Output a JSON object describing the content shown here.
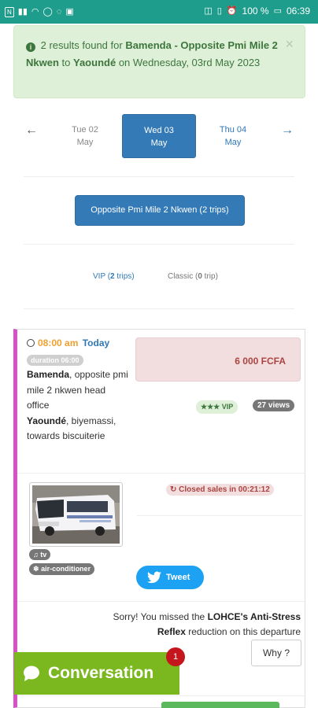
{
  "status_bar": {
    "left_icons": [
      "network-icon",
      "signal-icon",
      "wifi-icon",
      "whatsapp-icon",
      "circle-icon",
      "gallery-icon"
    ],
    "battery_percent": "100 %",
    "time": "06:39"
  },
  "alert": {
    "count_text": "2 results found for",
    "origin": "Bamenda - Opposite Pmi Mile 2 Nkwen",
    "to_text": "to",
    "destination": "Yaoundé",
    "date_text": "on Wednesday, 03rd May 2023",
    "close_label": "×"
  },
  "date_nav": {
    "prev_arrow": "←",
    "next_arrow": "→",
    "days": [
      {
        "day": "Tue 02",
        "month": "May",
        "active": false
      },
      {
        "day": "Wed 03",
        "month": "May",
        "active": true
      },
      {
        "day": "Thu 04",
        "month": "May",
        "active": false
      }
    ]
  },
  "departure_button": "Opposite Pmi Mile 2 Nkwen (2 trips)",
  "class_filters": {
    "vip_prefix": "VIP (",
    "vip_count": "2",
    "vip_suffix": " trips)",
    "classic_prefix": "Classic (",
    "classic_count": "0",
    "classic_suffix": " trip)"
  },
  "trip": {
    "time": "08:00 am",
    "day": "Today",
    "duration": "duration 06:00",
    "origin_city": "Bamenda",
    "origin_detail": ", opposite pmi mile 2 nkwen head office",
    "destination_city": "Yaoundé",
    "destination_detail": ", biyemassi, towards biscuiterie",
    "price": "6 000 FCFA",
    "class_badge": "VIP",
    "views": "27 views",
    "closed_sales": "Closed sales in 00:21:12",
    "amenities": [
      "tv",
      "air-conditioner"
    ],
    "tweet_label": "Tweet",
    "sorry_prefix": "Sorry! You missed the",
    "promo_name": "LOHCE's Anti-Stress Reflex",
    "sorry_suffix": "reduction on this departure",
    "why_button": "Why ?"
  },
  "chat": {
    "label": "Conversation",
    "unread": "1"
  },
  "colors": {
    "status_bar": "#1e9d8c",
    "primary": "#337ab7",
    "card_accent": "#d84fc8",
    "chat": "#7bb81f",
    "tweet": "#1da1f2"
  }
}
